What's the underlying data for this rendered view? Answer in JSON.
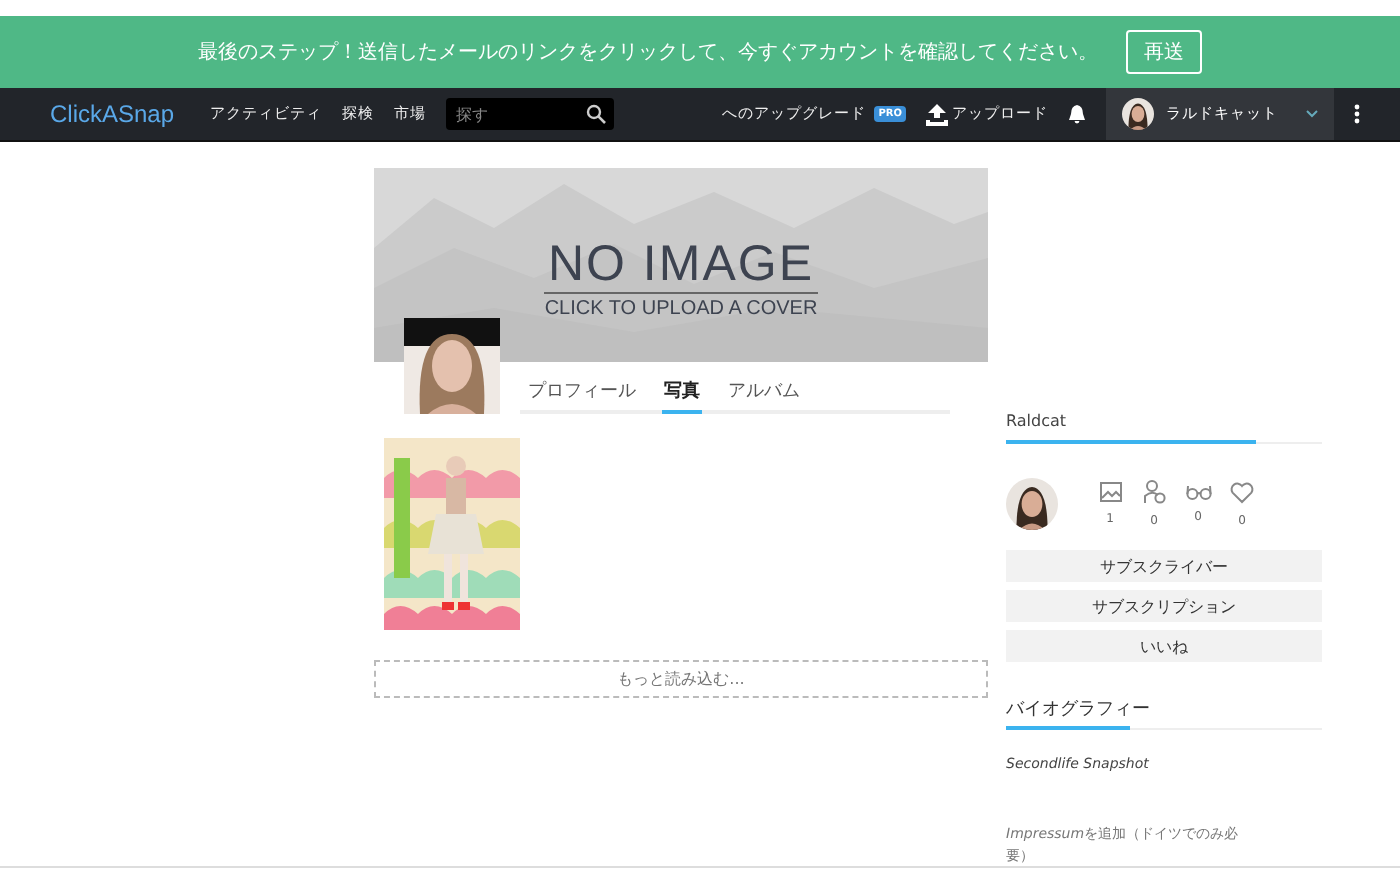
{
  "banner": {
    "message": "最後のステップ！送信したメールのリンクをクリックして、今すぐアカウントを確認してください。",
    "button": "再送"
  },
  "nav": {
    "logo": "ClickASnap",
    "links": [
      "アクティビティ",
      "探検",
      "市場"
    ],
    "search": {
      "placeholder": "探す"
    },
    "upgrade": "へのアップグレード",
    "pro_badge": "PRO",
    "upload": "アップロード",
    "user": "ラルドキャット"
  },
  "cover": {
    "title": "NO IMAGE",
    "subtitle": "CLICK TO UPLOAD A COVER"
  },
  "tabs": [
    {
      "label": "プロフィール",
      "selected": false
    },
    {
      "label": "写真",
      "selected": true
    },
    {
      "label": "アルバム",
      "selected": false
    }
  ],
  "load_more": "もっと読み込む...",
  "sidebar": {
    "username": "Raldcat",
    "stats": [
      {
        "kind": "photos",
        "count": "1"
      },
      {
        "kind": "followers",
        "count": "0"
      },
      {
        "kind": "views",
        "count": "0"
      },
      {
        "kind": "likes",
        "count": "0"
      }
    ],
    "buttons": [
      "サブスクライバー",
      "サブスクリプション",
      "いいね"
    ],
    "bio_heading": "バイオグラフィー",
    "bio": "Secondlife Snapshot",
    "impressum_term": "Impressum",
    "impressum": "を追加（ドイツでのみ必要）"
  }
}
